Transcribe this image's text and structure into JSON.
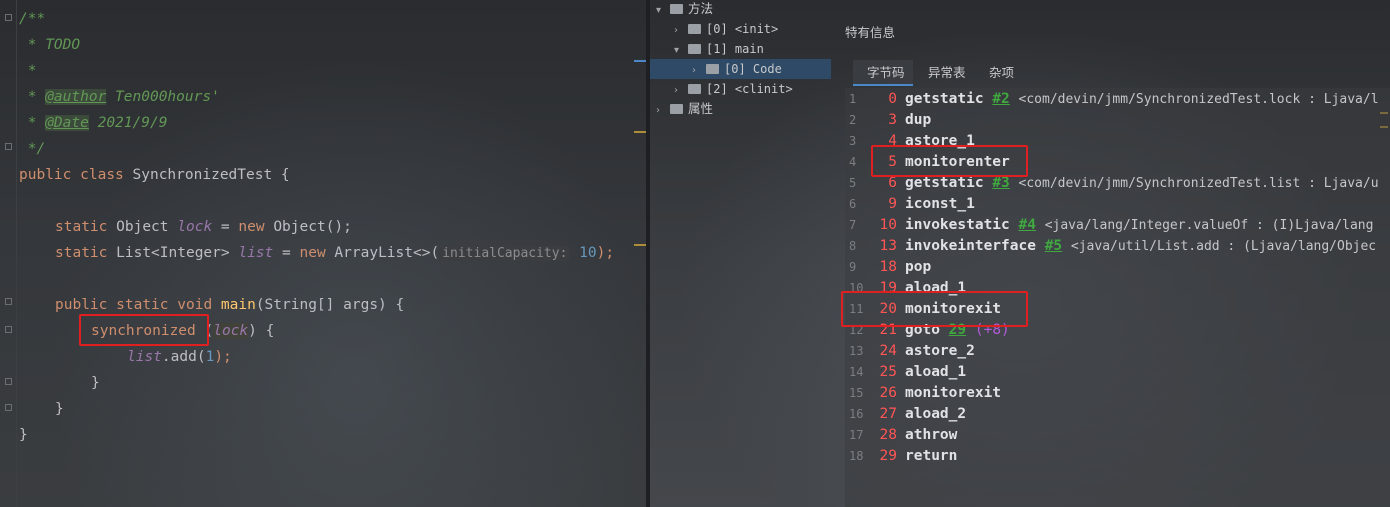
{
  "editor": {
    "lines": [
      {
        "type": "doc-open",
        "text": "/**"
      },
      {
        "type": "doc",
        "text": " * TODO"
      },
      {
        "type": "doc",
        "text": " *"
      },
      {
        "type": "doc-tag",
        "prefix": " * ",
        "tag": "@author",
        "rest": " Ten000hours'"
      },
      {
        "type": "doc-tag",
        "prefix": " * ",
        "tag": "@Date",
        "rest": " 2021/9/9"
      },
      {
        "type": "doc",
        "text": " */"
      }
    ],
    "class_decl": {
      "kw1": "public",
      "kw2": "class",
      "name": "SynchronizedTest",
      "brace": " {"
    },
    "field1": {
      "kw": "static",
      "type": "Object",
      "name": "lock",
      "eq": " = ",
      "new": "new",
      "ctor": "Object();"
    },
    "field2": {
      "kw": "static",
      "type": "List<Integer>",
      "name": "list",
      "eq": " = ",
      "new": "new",
      "ctor": "ArrayList<>(",
      "hint": "initialCapacity:",
      "num": "10",
      "tail": ");"
    },
    "method": {
      "kw1": "public",
      "kw2": "static",
      "kw3": "void",
      "name": "main",
      "params": "(String[] args) {"
    },
    "sync": {
      "kw": "synchronized",
      "open": " (",
      "arg": "lock",
      "close": ") {"
    },
    "call": {
      "obj": "list",
      "mid": ".add(",
      "num": "1",
      "tail": ");"
    },
    "close1": "}",
    "close2": "}",
    "close3": "}",
    "top_marker": "="
  },
  "viewer": {
    "tree": {
      "methods_label": "方法",
      "init": "[0] <init>",
      "main": "[1] main",
      "code": "[0] Code",
      "clinit": "[2] <clinit>",
      "attrs_label": "属性"
    },
    "special_title": "特有信息",
    "tabs": [
      "字节码",
      "异常表",
      "杂项"
    ],
    "bytecode": [
      {
        "ln": "1",
        "off": "0",
        "op": "getstatic",
        "ref": "#2",
        "cmt": "<com/devin/jmm/SynchronizedTest.lock : Ljava/l"
      },
      {
        "ln": "2",
        "off": "3",
        "op": "dup"
      },
      {
        "ln": "3",
        "off": "4",
        "op": "astore_1"
      },
      {
        "ln": "4",
        "off": "5",
        "op": "monitorenter"
      },
      {
        "ln": "5",
        "off": "6",
        "op": "getstatic",
        "ref": "#3",
        "cmt": "<com/devin/jmm/SynchronizedTest.list : Ljava/u"
      },
      {
        "ln": "6",
        "off": "9",
        "op": "iconst_1"
      },
      {
        "ln": "7",
        "off": "10",
        "op": "invokestatic",
        "ref": "#4",
        "cmt": "<java/lang/Integer.valueOf : (I)Ljava/lang"
      },
      {
        "ln": "8",
        "off": "13",
        "op": "invokeinterface",
        "ref": "#5",
        "cmt": "<java/util/List.add : (Ljava/lang/Objec"
      },
      {
        "ln": "9",
        "off": "18",
        "op": "pop"
      },
      {
        "ln": "10",
        "off": "19",
        "op": "aload_1"
      },
      {
        "ln": "11",
        "off": "20",
        "op": "monitorexit"
      },
      {
        "ln": "12",
        "off": "21",
        "op": "goto",
        "ref": "29",
        "jmp": "(+8)"
      },
      {
        "ln": "13",
        "off": "24",
        "op": "astore_2"
      },
      {
        "ln": "14",
        "off": "25",
        "op": "aload_1"
      },
      {
        "ln": "15",
        "off": "26",
        "op": "monitorexit"
      },
      {
        "ln": "16",
        "off": "27",
        "op": "aload_2"
      },
      {
        "ln": "17",
        "off": "28",
        "op": "athrow"
      },
      {
        "ln": "18",
        "off": "29",
        "op": "return"
      }
    ]
  },
  "colors": {
    "highlight_box": "#e02020",
    "accent_tab": "#4a88c7"
  }
}
